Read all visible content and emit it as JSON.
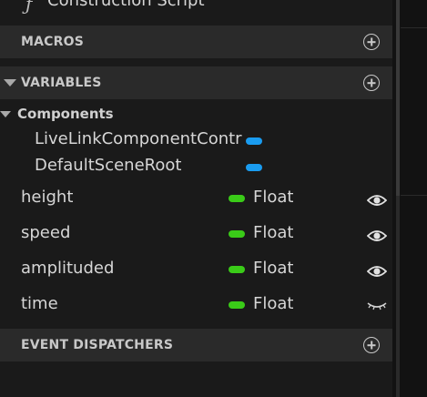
{
  "construction": {
    "label": "Construction Script",
    "icon": "function-icon"
  },
  "sections": {
    "macros": {
      "label": "MACROS"
    },
    "variables": {
      "label": "VARIABLES"
    },
    "event_dispatchers": {
      "label": "EVENT DISPATCHERS"
    }
  },
  "components": {
    "label": "Components",
    "items": [
      {
        "name": "LiveLinkComponentContr",
        "color": "#1a9cf0"
      },
      {
        "name": "DefaultSceneRoot",
        "color": "#1a9cf0"
      }
    ]
  },
  "variables": [
    {
      "name": "height",
      "type": "Float",
      "type_color": "#3acb18",
      "visibility": "eye-open-icon"
    },
    {
      "name": "speed",
      "type": "Float",
      "type_color": "#3acb18",
      "visibility": "eye-open-icon"
    },
    {
      "name": "amplituded",
      "type": "Float",
      "type_color": "#3acb18",
      "visibility": "eye-open-icon"
    },
    {
      "name": "time",
      "type": "Float",
      "type_color": "#3acb18",
      "visibility": "eye-closed-icon"
    }
  ],
  "colors": {
    "header_bg": "#2a2a2a",
    "panel_bg": "#1a1a1a",
    "text": "#d6d6d6",
    "component_pill": "#1a9cf0",
    "float_pill": "#3acb18"
  }
}
